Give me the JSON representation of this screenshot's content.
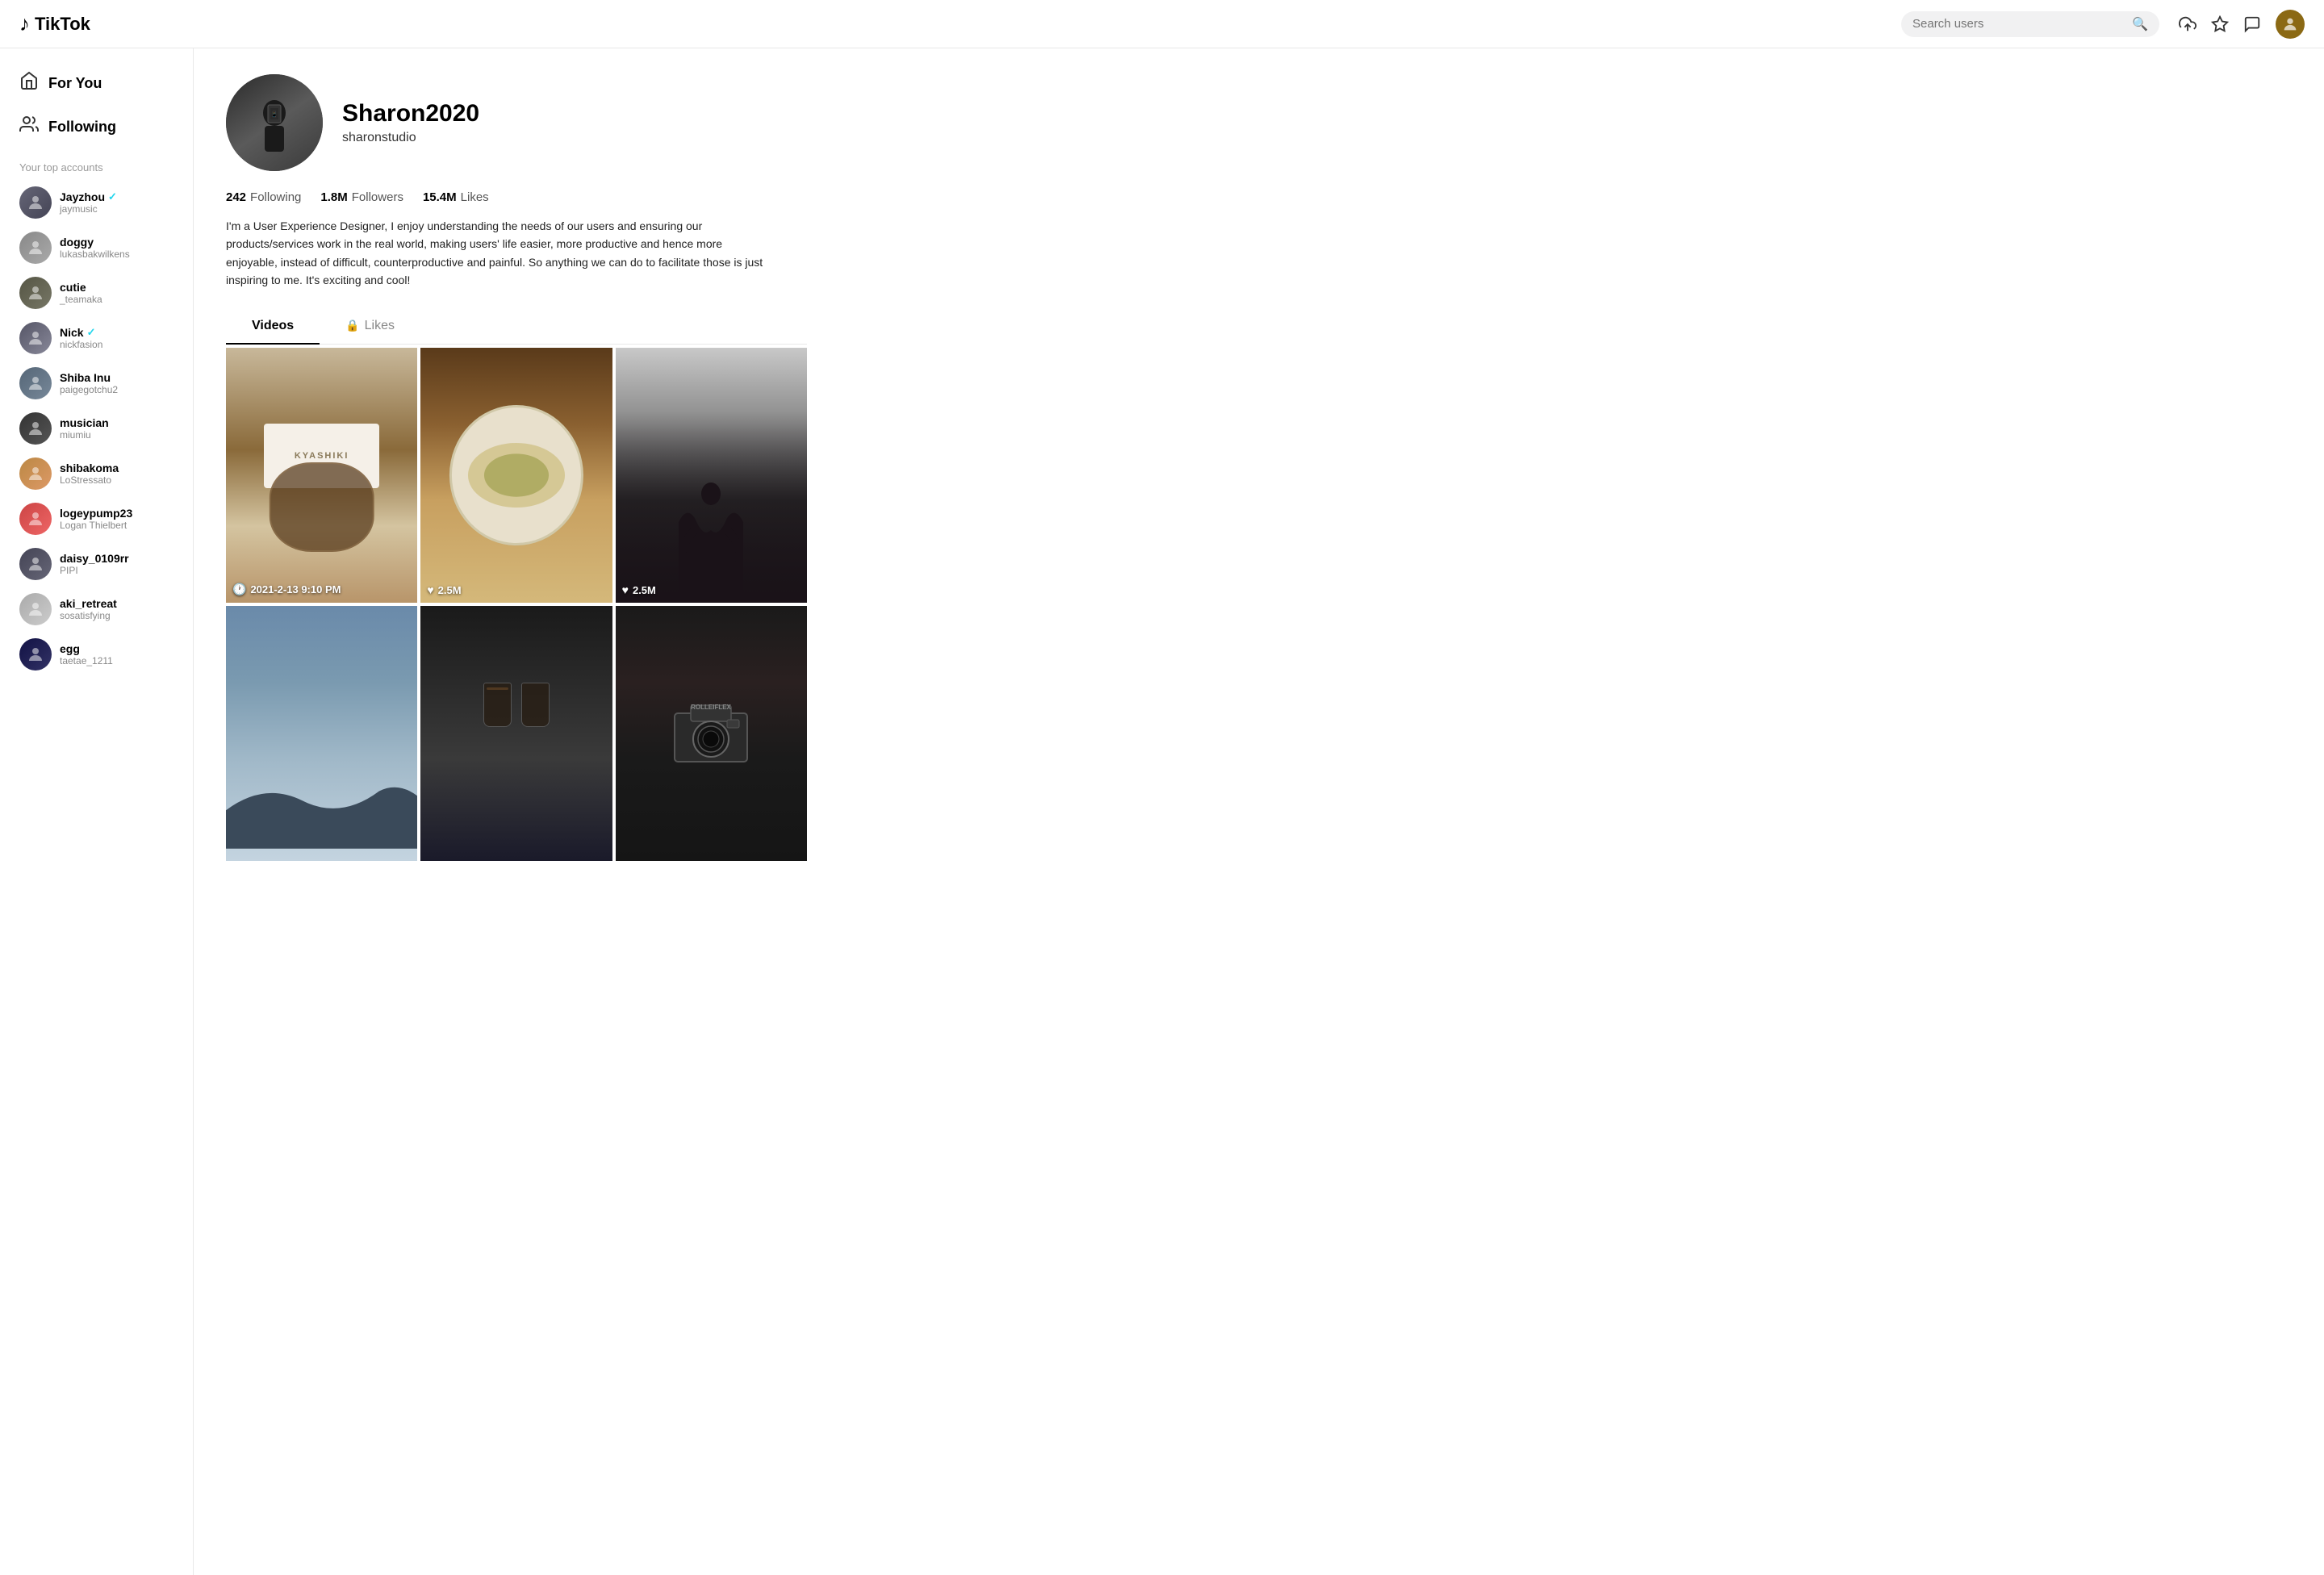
{
  "header": {
    "logo_text": "TikTok",
    "search_placeholder": "Search users"
  },
  "sidebar": {
    "nav": [
      {
        "id": "for-you",
        "label": "For You",
        "icon": "🏠"
      },
      {
        "id": "following",
        "label": "Following",
        "icon": "👥"
      }
    ],
    "top_accounts_label": "Your top accounts",
    "accounts": [
      {
        "id": "jayzhou",
        "name": "Jayzhou",
        "handle": "jaymusic",
        "verified": true,
        "color_class": "av-jayzhou"
      },
      {
        "id": "doggy",
        "name": "doggy",
        "handle": "lukasbakwilkens",
        "verified": false,
        "color_class": "av-doggy"
      },
      {
        "id": "cutie",
        "name": "cutie",
        "handle": "_teamaka",
        "verified": false,
        "color_class": "av-cutie"
      },
      {
        "id": "nick",
        "name": "Nick",
        "handle": "nickfasion",
        "verified": true,
        "color_class": "av-nick"
      },
      {
        "id": "shiba-inu",
        "name": "Shiba Inu",
        "handle": "paigegotchu2",
        "verified": false,
        "color_class": "av-shiba"
      },
      {
        "id": "musician",
        "name": "musician",
        "handle": "miumiu",
        "verified": false,
        "color_class": "av-musician"
      },
      {
        "id": "shibakoma",
        "name": "shibakoma",
        "handle": "LoStressato",
        "verified": false,
        "color_class": "av-shiba2"
      },
      {
        "id": "logeypump23",
        "name": "logeypump23",
        "handle": "Logan Thielbert",
        "verified": false,
        "color_class": "av-logeypump"
      },
      {
        "id": "daisy",
        "name": "daisy_0109rr",
        "handle": "PIPI",
        "verified": false,
        "color_class": "av-daisy"
      },
      {
        "id": "aki",
        "name": "aki_retreat",
        "handle": "sosatisfying",
        "verified": false,
        "color_class": "av-aki"
      },
      {
        "id": "egg",
        "name": "egg",
        "handle": "taetae_1211",
        "verified": false,
        "color_class": "av-egg"
      }
    ]
  },
  "profile": {
    "display_name": "Sharon2020",
    "username": "sharonstudio",
    "stats": {
      "following_count": "242",
      "following_label": "Following",
      "followers_count": "1.8M",
      "followers_label": "Followers",
      "likes_count": "15.4M",
      "likes_label": "Likes"
    },
    "bio": "I'm a User Experience Designer, I enjoy understanding the needs of our users and ensuring our products/services work in the real world, making users' life easier, more productive and hence more enjoyable, instead of difficult, counterproductive and painful. So anything we can do to facilitate those is just inspiring to me. It's exciting and cool!",
    "tabs": [
      {
        "id": "videos",
        "label": "Videos",
        "locked": false,
        "active": true
      },
      {
        "id": "likes",
        "label": "Likes",
        "locked": true,
        "active": false
      }
    ],
    "videos": [
      {
        "id": "v1",
        "thumb_class": "thumb-1",
        "overlay_type": "date",
        "overlay_text": "2021-2-13 9:10 PM"
      },
      {
        "id": "v2",
        "thumb_class": "thumb-2",
        "overlay_type": "likes",
        "overlay_text": "2.5M"
      },
      {
        "id": "v3",
        "thumb_class": "thumb-3",
        "overlay_type": "likes",
        "overlay_text": "2.5M"
      },
      {
        "id": "v4",
        "thumb_class": "thumb-4",
        "overlay_type": "none",
        "overlay_text": ""
      },
      {
        "id": "v5",
        "thumb_class": "thumb-5",
        "overlay_type": "none",
        "overlay_text": ""
      },
      {
        "id": "v6",
        "thumb_class": "thumb-6",
        "overlay_type": "none",
        "overlay_text": ""
      }
    ]
  }
}
